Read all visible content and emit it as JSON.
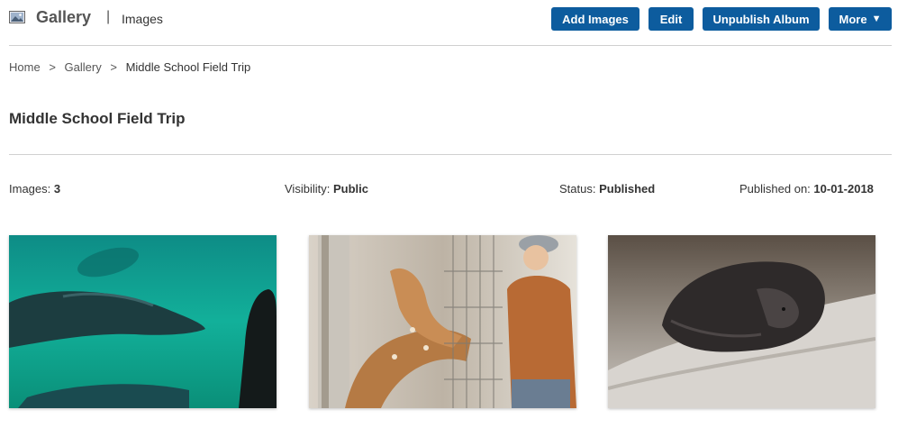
{
  "header": {
    "app_title": "Gallery",
    "separator": "|",
    "section": "Images",
    "icon": "image-icon"
  },
  "toolbar": {
    "add_images": "Add Images",
    "edit": "Edit",
    "unpublish": "Unpublish Album",
    "more": "More",
    "more_caret": "▼",
    "button_color": "#0d5c9e"
  },
  "breadcrumb": {
    "items": [
      "Home",
      "Gallery",
      "Middle School Field Trip"
    ],
    "separator": ">"
  },
  "album": {
    "title": "Middle School Field Trip",
    "images_label": "Images:",
    "images_count": "3",
    "visibility_label": "Visibility:",
    "visibility_value": "Public",
    "status_label": "Status:",
    "status_value": "Published",
    "published_label": "Published on:",
    "published_value": "10-01-2018"
  },
  "thumbnails": [
    {
      "subject": "sea lions swimming underwater"
    },
    {
      "subject": "child feeding deer through fence"
    },
    {
      "subject": "fur seal sleeping on rock"
    }
  ]
}
